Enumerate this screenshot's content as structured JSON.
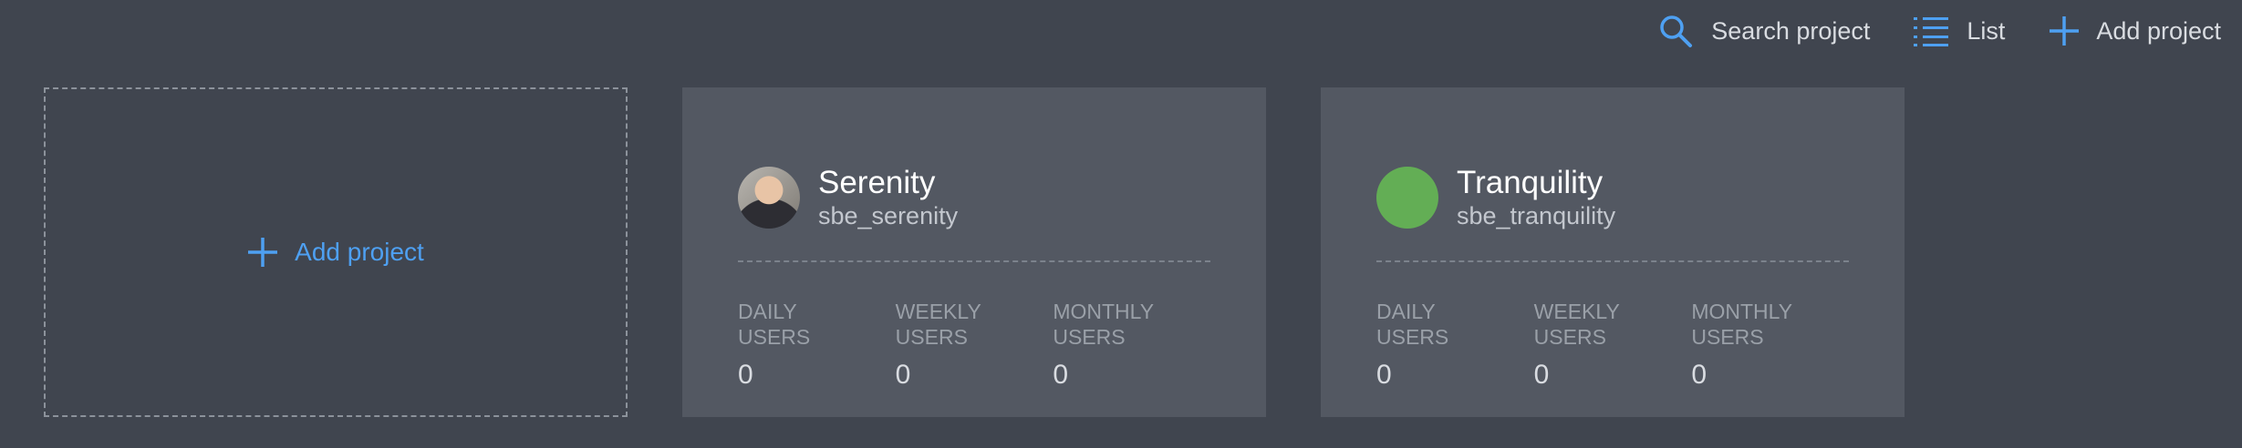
{
  "toolbar": {
    "search_label": "Search project",
    "list_label": "List",
    "add_label": "Add project"
  },
  "add_card": {
    "label": "Add project"
  },
  "projects": [
    {
      "name": "Serenity",
      "slug": "sbe_serenity",
      "avatar": "user-photo",
      "stats": [
        {
          "label": "DAILY\nUSERS",
          "value": "0"
        },
        {
          "label": "WEEKLY\nUSERS",
          "value": "0"
        },
        {
          "label": "MONTHLY\nUSERS",
          "value": "0"
        }
      ]
    },
    {
      "name": "Tranquility",
      "slug": "sbe_tranquility",
      "avatar": "green-circle",
      "stats": [
        {
          "label": "DAILY\nUSERS",
          "value": "0"
        },
        {
          "label": "WEEKLY\nUSERS",
          "value": "0"
        },
        {
          "label": "MONTHLY\nUSERS",
          "value": "0"
        }
      ]
    }
  ],
  "colors": {
    "background": "#40454f",
    "card": "#535862",
    "accent": "#4ea0f2",
    "avatar_green": "#63ae55"
  }
}
